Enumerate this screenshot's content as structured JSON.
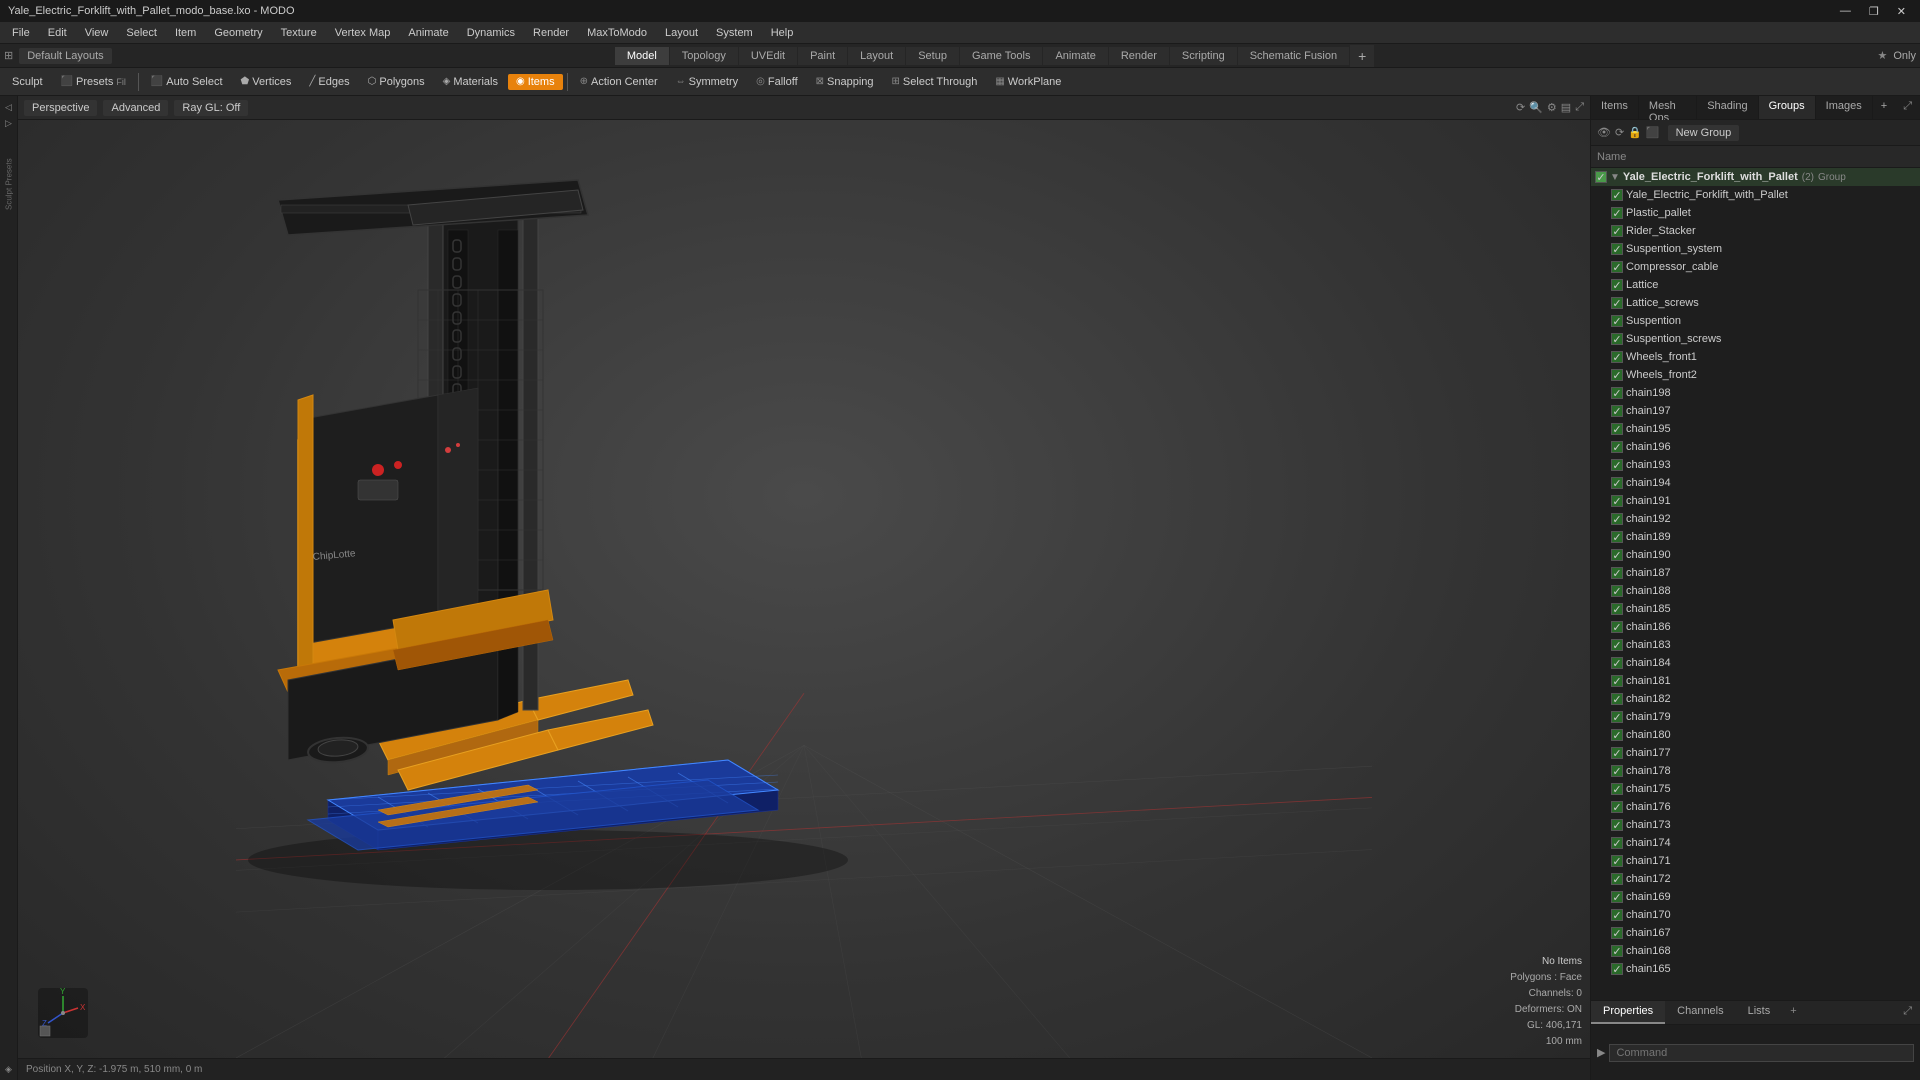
{
  "window": {
    "title": "Yale_Electric_Forklift_with_Pallet_modo_base.lxo - MODO"
  },
  "title_bar": {
    "controls": [
      "—",
      "❐",
      "✕"
    ]
  },
  "menu_bar": {
    "items": [
      "File",
      "Edit",
      "View",
      "Select",
      "Item",
      "Geometry",
      "Texture",
      "Vertex Map",
      "Animate",
      "Dynamics",
      "Render",
      "MaxToModo",
      "Layout",
      "System",
      "Help"
    ]
  },
  "layout_bar": {
    "left_label": "Default Layouts",
    "tabs": [
      "Model",
      "Topology",
      "UVEdit",
      "Paint",
      "Layout",
      "Setup",
      "Game Tools",
      "Animate",
      "Render",
      "Scripting",
      "Schematic Fusion"
    ],
    "active_tab": "Model",
    "add_button": "+",
    "right_label": "Only",
    "star_icon": "★"
  },
  "toolbar": {
    "sculpt_label": "Sculpt",
    "presets_label": "Presets",
    "auto_select_label": "Auto Select",
    "vertices_label": "Vertices",
    "edges_label": "Edges",
    "polygons_label": "Polygons",
    "materials_label": "Materials",
    "items_label": "Items",
    "action_center_label": "Action Center",
    "symmetry_label": "Symmetry",
    "falloff_label": "Falloff",
    "snapping_label": "Snapping",
    "select_through_label": "Select Through",
    "workplane_label": "WorkPlane"
  },
  "viewport": {
    "perspective_label": "Perspective",
    "advanced_label": "Advanced",
    "ray_gl_label": "Ray GL: Off"
  },
  "status": {
    "no_items": "No Items",
    "polygons": "Polygons : Face",
    "channels": "Channels: 0",
    "deformers": "Deformers: ON",
    "gl_coords": "GL: 406,171",
    "size": "100 mm"
  },
  "position_bar": {
    "text": "Position X, Y, Z:  -1.975 m, 510 mm, 0 m"
  },
  "right_panel": {
    "tabs": [
      "Items",
      "Mesh Ops",
      "Shading",
      "Groups",
      "Images"
    ],
    "active_tab": "Groups",
    "add_tab": "+"
  },
  "groups_panel": {
    "new_group_btn": "New Group",
    "name_header": "Name",
    "root_item": {
      "name": "Yale_Electric_Forklift_with_Pallet",
      "count": "(2)",
      "type": "Group"
    },
    "items": [
      {
        "name": "Yale_Electric_Forklift_with_Pallet",
        "indent": 1
      },
      {
        "name": "Plastic_pallet",
        "indent": 1
      },
      {
        "name": "Rider_Stacker",
        "indent": 1
      },
      {
        "name": "Suspention_system",
        "indent": 1
      },
      {
        "name": "Compressor_cable",
        "indent": 1
      },
      {
        "name": "Lattice",
        "indent": 1
      },
      {
        "name": "Lattice_screws",
        "indent": 1
      },
      {
        "name": "Suspention",
        "indent": 1
      },
      {
        "name": "Suspention_screws",
        "indent": 1
      },
      {
        "name": "Wheels_front1",
        "indent": 1
      },
      {
        "name": "Wheels_front2",
        "indent": 1
      },
      {
        "name": "chain198",
        "indent": 1
      },
      {
        "name": "chain197",
        "indent": 1
      },
      {
        "name": "chain195",
        "indent": 1
      },
      {
        "name": "chain196",
        "indent": 1
      },
      {
        "name": "chain193",
        "indent": 1
      },
      {
        "name": "chain194",
        "indent": 1
      },
      {
        "name": "chain191",
        "indent": 1
      },
      {
        "name": "chain192",
        "indent": 1
      },
      {
        "name": "chain189",
        "indent": 1
      },
      {
        "name": "chain190",
        "indent": 1
      },
      {
        "name": "chain187",
        "indent": 1
      },
      {
        "name": "chain188",
        "indent": 1
      },
      {
        "name": "chain185",
        "indent": 1
      },
      {
        "name": "chain186",
        "indent": 1
      },
      {
        "name": "chain183",
        "indent": 1
      },
      {
        "name": "chain184",
        "indent": 1
      },
      {
        "name": "chain181",
        "indent": 1
      },
      {
        "name": "chain182",
        "indent": 1
      },
      {
        "name": "chain179",
        "indent": 1
      },
      {
        "name": "chain180",
        "indent": 1
      },
      {
        "name": "chain177",
        "indent": 1
      },
      {
        "name": "chain178",
        "indent": 1
      },
      {
        "name": "chain175",
        "indent": 1
      },
      {
        "name": "chain176",
        "indent": 1
      },
      {
        "name": "chain173",
        "indent": 1
      },
      {
        "name": "chain174",
        "indent": 1
      },
      {
        "name": "chain171",
        "indent": 1
      },
      {
        "name": "chain172",
        "indent": 1
      },
      {
        "name": "chain169",
        "indent": 1
      },
      {
        "name": "chain170",
        "indent": 1
      },
      {
        "name": "chain167",
        "indent": 1
      },
      {
        "name": "chain168",
        "indent": 1
      },
      {
        "name": "chain165",
        "indent": 1
      }
    ]
  },
  "bottom_panel": {
    "tabs": [
      "Properties",
      "Channels",
      "Lists"
    ],
    "add_tab": "+",
    "command_arrow": "▶",
    "command_placeholder": "Command"
  },
  "colors": {
    "active_tab": "#e8820c",
    "selected_item": "#1a3a5a",
    "group_bg": "#2a3a2a",
    "checkbox_green": "#2a6a2a",
    "body_bg": "#2b2b2b"
  }
}
